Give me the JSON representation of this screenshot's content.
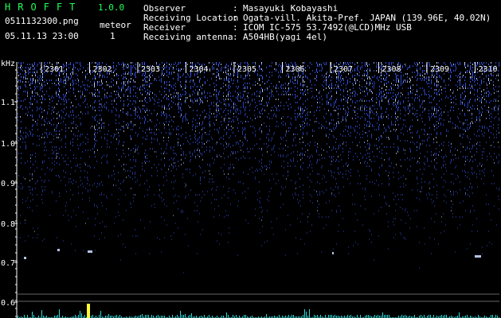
{
  "header": {
    "app_name": "HROFFT",
    "version": "1.0.0",
    "file_name": "0511132300.png",
    "datetime": "05.11.13 23:00",
    "meteor_label": "meteor",
    "meteor_count": "1",
    "info": [
      {
        "label": "Observer",
        "value": "Masayuki Kobayashi"
      },
      {
        "label": "Receiving Location",
        "value": "Ogata-vill. Akita-Pref. JAPAN (139.96E, 40.02N)"
      },
      {
        "label": "Receiver",
        "value": "ICOM IC-575 53.7492(@LCD)MHz USB"
      },
      {
        "label": "Receiving antenna",
        "value": "A504HB(yagi 4el)"
      }
    ]
  },
  "spectrogram": {
    "y_unit": "kHz",
    "y_ticks": [
      "1.1",
      "1.0",
      "0.9",
      "0.8",
      "0.7",
      "0.6"
    ],
    "time_ticks": [
      "2301",
      "2302",
      "2303",
      "2304",
      "2305",
      "2306",
      "2307",
      "2308",
      "2309",
      "2310"
    ],
    "colors": {
      "signal": "#3a5cff",
      "bright": "#c8d8ff",
      "axis": "#ffffff",
      "echo": "#ffff33",
      "trace": "#33ffff"
    }
  }
}
